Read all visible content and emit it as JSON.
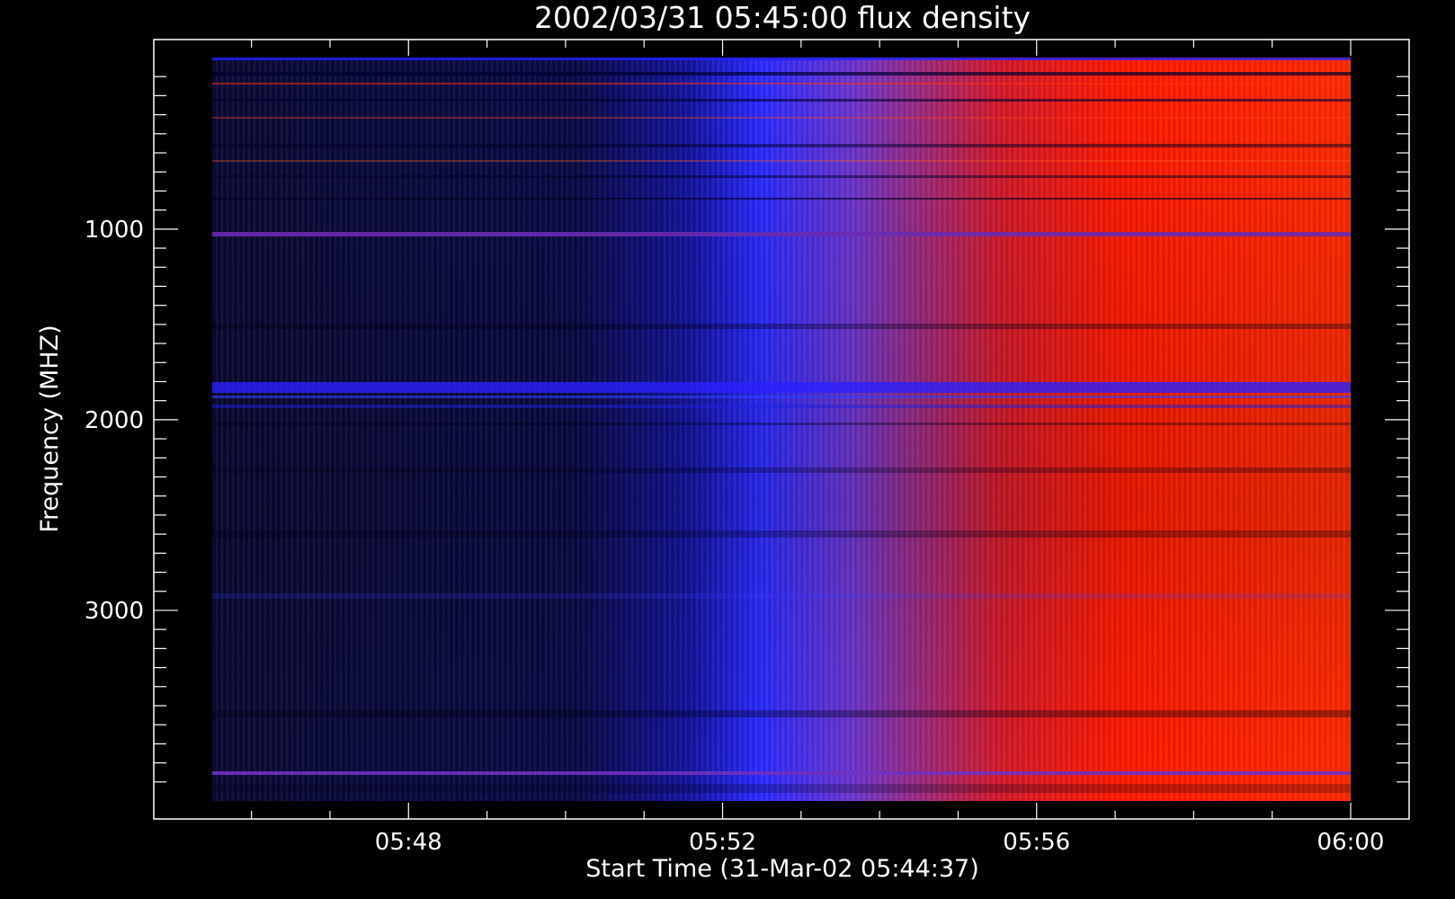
{
  "chart_data": {
    "type": "heatmap",
    "title": "2002/03/31 05:45:00 flux density",
    "xlabel": "Start Time (31-Mar-02 05:44:37)",
    "ylabel": "Frequency (MHZ)",
    "x_range_minutes": [
      45.5,
      60
    ],
    "x_ticks": [
      {
        "label": "05:48",
        "minute": 48
      },
      {
        "label": "05:52",
        "minute": 52
      },
      {
        "label": "05:56",
        "minute": 56
      },
      {
        "label": "06:00",
        "minute": 60
      }
    ],
    "y_range": [
      100,
      4000
    ],
    "y_inverted": true,
    "y_ticks": [
      {
        "label": "1000",
        "value": 1000
      },
      {
        "label": "2000",
        "value": 2000
      },
      {
        "label": "3000",
        "value": 3000
      }
    ],
    "colormap": [
      "#000000",
      "#0a0a3c",
      "#1010c8",
      "#2a2aff",
      "#7030c0",
      "#b02050",
      "#ff2200",
      "#ff5500",
      "#ffb030"
    ],
    "grid": false,
    "description_of_pattern": "low flux (dark blue) before ~05:51 rising through a blue-violet transition to high flux (red) after ~05:55"
  }
}
